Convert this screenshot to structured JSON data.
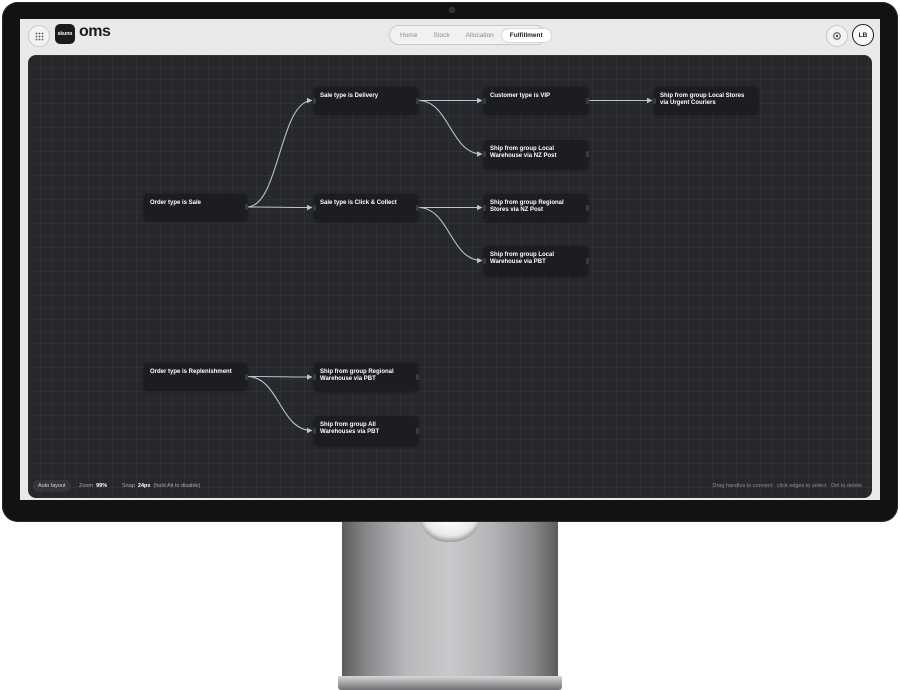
{
  "app": {
    "logo_badge": "skuno",
    "logo_text": "oms"
  },
  "nav": {
    "tabs": [
      {
        "label": "Home",
        "active": false
      },
      {
        "label": "Stock",
        "active": false
      },
      {
        "label": "Allocation",
        "active": false
      },
      {
        "label": "Fulfillment",
        "active": true
      }
    ]
  },
  "user": {
    "initials": "LB"
  },
  "icons": {
    "apps": "grid-icon",
    "settings": "settings-icon"
  },
  "flow": {
    "nodes": [
      {
        "id": "order-sale",
        "label": "Order type is Sale"
      },
      {
        "id": "sale-delivery",
        "label": "Sale type is Delivery"
      },
      {
        "id": "sale-click-collect",
        "label": "Sale type is Click & Collect"
      },
      {
        "id": "customer-vip",
        "label": "Customer type is VIP"
      },
      {
        "id": "ship-local-stores-urgent",
        "label": "Ship from group Local Stores via Urgent Couriers"
      },
      {
        "id": "ship-local-wh-nzpost",
        "label": "Ship from group Local Warehouse via NZ Post"
      },
      {
        "id": "ship-regional-stores-nzpost",
        "label": "Ship from group Regional Stores via NZ Post"
      },
      {
        "id": "ship-local-wh-pbt",
        "label": "Ship from group Local Warehouse via PBT"
      },
      {
        "id": "order-replenishment",
        "label": "Order type is Replenishment"
      },
      {
        "id": "ship-regional-wh-pbt",
        "label": "Ship from group Regional Warehouse via PBT"
      },
      {
        "id": "ship-all-wh-pbt",
        "label": "Ship from group All Warehouses via PBT"
      }
    ],
    "edges": [
      [
        "order-sale",
        "sale-delivery"
      ],
      [
        "order-sale",
        "sale-click-collect"
      ],
      [
        "sale-delivery",
        "customer-vip"
      ],
      [
        "sale-delivery",
        "ship-local-wh-nzpost"
      ],
      [
        "customer-vip",
        "ship-local-stores-urgent"
      ],
      [
        "sale-click-collect",
        "ship-regional-stores-nzpost"
      ],
      [
        "sale-click-collect",
        "ship-local-wh-pbt"
      ],
      [
        "order-replenishment",
        "ship-regional-wh-pbt"
      ],
      [
        "order-replenishment",
        "ship-all-wh-pbt"
      ]
    ]
  },
  "toolbar": {
    "auto_layout": "Auto layout",
    "zoom_label": "Zoom",
    "zoom_value": "99%",
    "snap_label": "Snap",
    "snap_value": "24px",
    "snap_hint": "(hold Alt to disable)",
    "help_text": "Drag handles to connect · click edges to select · Del to delete"
  },
  "colors": {
    "canvas": "#27282b",
    "node": "#1c1d20",
    "edge": "#b9c2d6",
    "accent": "#1c1c1e"
  }
}
